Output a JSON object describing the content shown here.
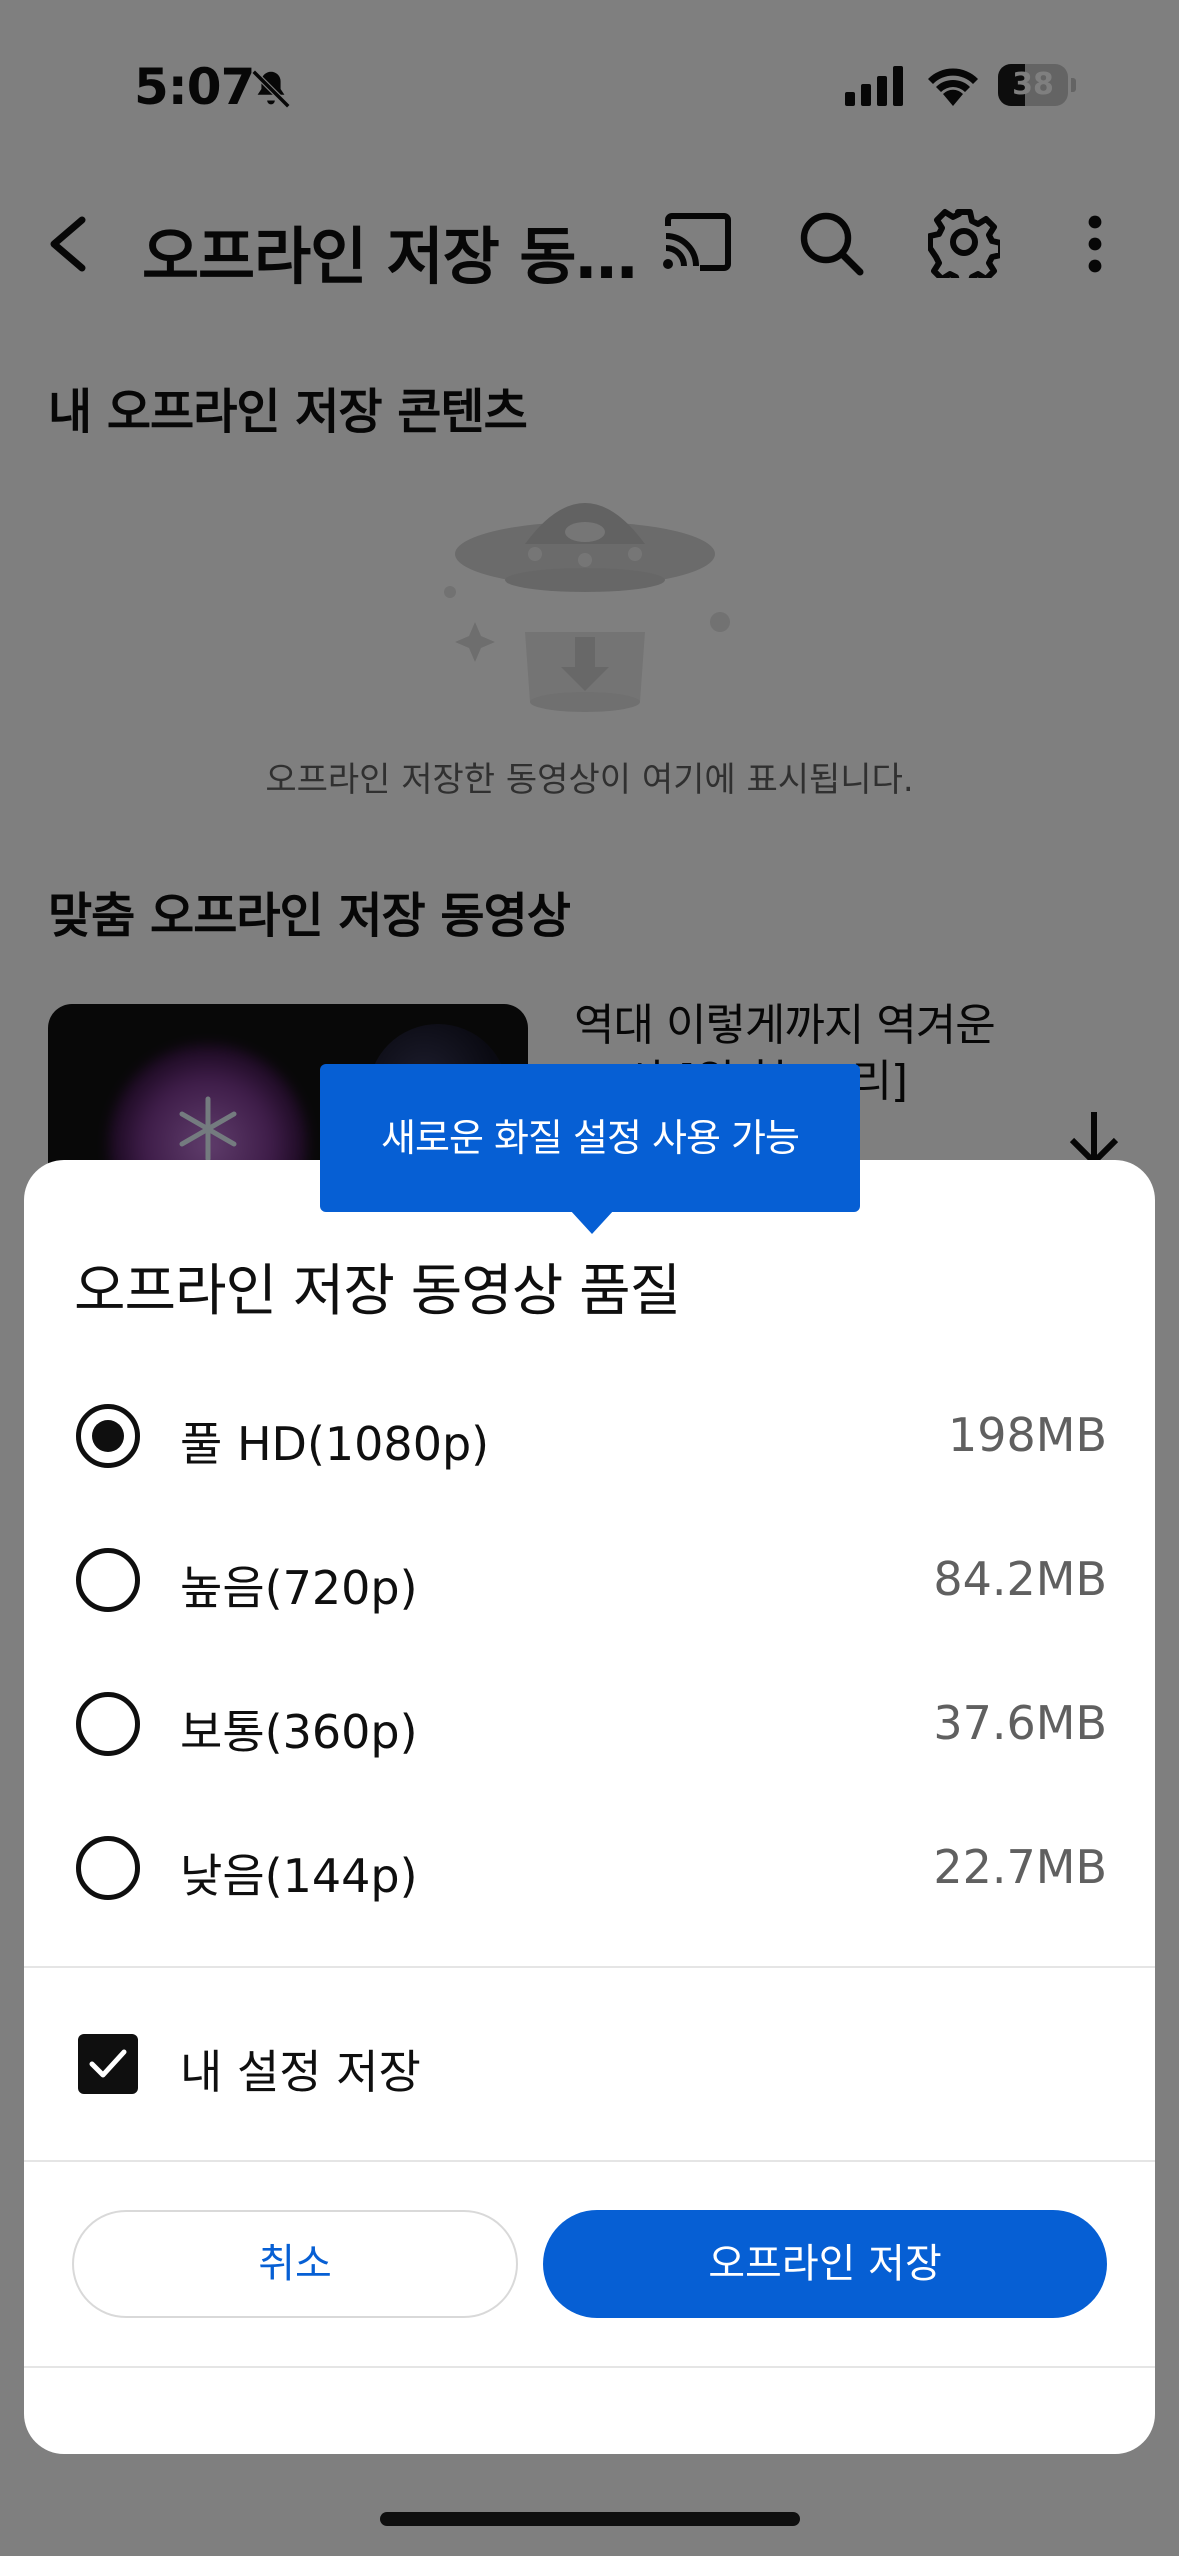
{
  "status_bar": {
    "time": "5:07",
    "battery_level": "38",
    "battery_fraction": 0.38
  },
  "app_bar": {
    "title": "오프라인 저장 동영상",
    "icons": [
      "back-icon",
      "cast-icon",
      "search-icon",
      "gear-icon",
      "more-icon"
    ]
  },
  "my_offline": {
    "heading": "내 오프라인 저장 콘텐츠",
    "empty_message": "오프라인 저장한 동영상이 여기에 표시됩니다."
  },
  "recommended": {
    "heading": "맞춤 오프라인 저장 동영상",
    "video_title": "역대 이렇게까지 역겨운 ... 사 [위 형 ... 리]"
  },
  "tooltip": {
    "text": "새로운 화질 설정 사용 가능"
  },
  "sheet": {
    "title": "오프라인 저장 동영상 품질",
    "options": [
      {
        "label": "풀 HD(1080p)",
        "size": "198MB",
        "selected": true
      },
      {
        "label": "높음(720p)",
        "size": "84.2MB",
        "selected": false
      },
      {
        "label": "보통(360p)",
        "size": "37.6MB",
        "selected": false
      },
      {
        "label": "낮음(144p)",
        "size": "22.7MB",
        "selected": false
      }
    ],
    "remember_label": "내 설정 저장",
    "remember_checked": true,
    "cancel_label": "취소",
    "confirm_label": "오프라인 저장"
  },
  "colors": {
    "accent": "#065fd4",
    "overlay": "rgba(0,0,0,0.5)",
    "text_primary": "#0f0f0f",
    "text_secondary": "#606060"
  }
}
